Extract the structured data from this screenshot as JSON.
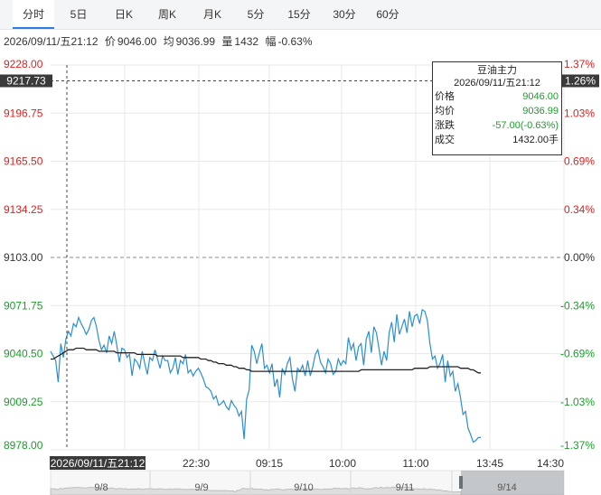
{
  "tabs": [
    "分时",
    "5日",
    "日K",
    "周K",
    "月K",
    "5分",
    "15分",
    "30分",
    "60分"
  ],
  "active_tab": 0,
  "info": {
    "datetime": "2026/09/11/五21:12",
    "price_label": "价",
    "price": "9046.00",
    "avg_label": "均",
    "avg": "9036.99",
    "volume_label": "量",
    "volume": "1432",
    "change_label": "幅",
    "change": "-0.63%"
  },
  "tooltip": {
    "title": "豆油主力",
    "datetime": "2026/09/11/五21:12",
    "rows": [
      {
        "label": "价格",
        "value": "9046.00",
        "color": "#1a9e2a"
      },
      {
        "label": "均价",
        "value": "9036.99",
        "color": "#1a9e2a"
      },
      {
        "label": "涨跌",
        "value": "-57.00(-0.63%)",
        "color": "#1a9e2a"
      },
      {
        "label": "成交",
        "value": "1432.00手",
        "color": "#222222"
      }
    ]
  },
  "crosshair": {
    "price_label": "9217.73",
    "pct_label": "1.26%",
    "time_label": "2026/09/11/五21:12"
  },
  "navigator": {
    "days": [
      "9/8",
      "9/9",
      "9/10",
      "9/11",
      "9/14"
    ]
  },
  "colors": {
    "up": "#e02020",
    "down": "#1a9e2a",
    "price_line": "#2b8fd0",
    "avg_line": "#222222"
  },
  "chart_data": {
    "type": "line",
    "title": "豆油主力",
    "y_ticks": [
      "9228.00",
      "9196.75",
      "9165.50",
      "9134.25",
      "9103.00",
      "9071.75",
      "9040.50",
      "9009.25",
      "8978.00"
    ],
    "pct_ticks": [
      "1.37%",
      "1.03%",
      "0.69%",
      "0.34%",
      "0.00%",
      "-0.34%",
      "-0.69%",
      "-1.03%",
      "-1.37%"
    ],
    "ylim": [
      8978.0,
      9228.0
    ],
    "prev_close": 9103.0,
    "x_ticks": [
      "22:30",
      "09:15",
      "10:00",
      "11:00",
      "13:45",
      "14:30"
    ],
    "grid": true,
    "series": [
      {
        "name": "价格",
        "values": [
          9042,
          9039,
          9036,
          9022,
          9047,
          9038,
          9050,
          9055,
          9052,
          9060,
          9058,
          9064,
          9060,
          9057,
          9053,
          9056,
          9062,
          9064,
          9058,
          9049,
          9043,
          9046,
          9041,
          9052,
          9047,
          9055,
          9046,
          9035,
          9044,
          9043,
          9038,
          9040,
          9026,
          9037,
          9035,
          9031,
          9042,
          9034,
          9027,
          9038,
          9036,
          9043,
          9037,
          9031,
          9039,
          9036,
          9036,
          9028,
          9031,
          9038,
          9027,
          9036,
          9034,
          9040,
          9028,
          9030,
          9026,
          9029,
          9031,
          9028,
          9024,
          9019,
          9018,
          9016,
          9011,
          9013,
          9007,
          9008,
          9010,
          9006,
          9004,
          9010,
          9007,
          9005,
          9000,
          9003,
          8985,
          9011,
          9017,
          9046,
          9042,
          9034,
          9041,
          9047,
          9031,
          9033,
          9028,
          9034,
          9019,
          9024,
          9012,
          9031,
          9027,
          9034,
          9038,
          9024,
          9016,
          9031,
          9029,
          9033,
          9026,
          9036,
          9026,
          9032,
          9040,
          9043,
          9035,
          9032,
          9028,
          9037,
          9034,
          9027,
          9029,
          9037,
          9033,
          9036,
          9034,
          9051,
          9043,
          9047,
          9036,
          9045,
          9047,
          9033,
          9050,
          9055,
          9041,
          9058,
          9054,
          9044,
          9033,
          9042,
          9036,
          9054,
          9061,
          9048,
          9066,
          9053,
          9058,
          9063,
          9054,
          9068,
          9058,
          9065,
          9066,
          9060,
          9069,
          9068,
          9062,
          9047,
          9037,
          9039,
          9031,
          9034,
          9040,
          9022,
          9036,
          9026,
          9029,
          9016,
          9021,
          9012,
          9001,
          9003,
          8992,
          8988,
          8983,
          8984,
          8986,
          8986
        ],
        "color": "#2b8fd0"
      },
      {
        "name": "均价",
        "values": [
          9037,
          9037,
          9038,
          9039,
          9040,
          9041,
          9042,
          9043,
          9043,
          9043,
          9044,
          9044,
          9044,
          9044,
          9043,
          9043,
          9043,
          9043,
          9043,
          9042,
          9042,
          9042,
          9042,
          9042,
          9042,
          9042,
          9041,
          9041,
          9041,
          9041,
          9041,
          9041,
          9041,
          9041,
          9040,
          9040,
          9040,
          9040,
          9040,
          9040,
          9040,
          9040,
          9039,
          9039,
          9039,
          9039,
          9039,
          9039,
          9039,
          9039,
          9039,
          9039,
          9038,
          9038,
          9038,
          9038,
          9038,
          9038,
          9038,
          9037,
          9037,
          9037,
          9036,
          9036,
          9035,
          9035,
          9034,
          9034,
          9034,
          9033,
          9033,
          9033,
          9032,
          9032,
          9031,
          9031,
          9031,
          9030,
          9030,
          9029,
          9029,
          9029,
          9029,
          9029,
          9029,
          9029,
          9029,
          9029,
          9029,
          9029,
          9029,
          9029,
          9029,
          9029,
          9029,
          9029,
          9029,
          9029,
          9029,
          9029,
          9029,
          9029,
          9029,
          9029,
          9029,
          9029,
          9029,
          9029,
          9029,
          9029,
          9029,
          9029,
          9029,
          9029,
          9029,
          9029,
          9029,
          9029,
          9029,
          9029,
          9029,
          9029,
          9030,
          9030,
          9030,
          9030,
          9030,
          9030,
          9030,
          9030,
          9030,
          9030,
          9030,
          9030,
          9030,
          9030,
          9030,
          9030,
          9030,
          9030,
          9030,
          9030,
          9030,
          9031,
          9031,
          9031,
          9031,
          9031,
          9031,
          9032,
          9032,
          9032,
          9032,
          9032,
          9032,
          9032,
          9032,
          9032,
          9032,
          9032,
          9032,
          9031,
          9031,
          9031,
          9031,
          9030,
          9030,
          9029,
          9028,
          9028
        ],
        "color": "#222222"
      }
    ]
  }
}
